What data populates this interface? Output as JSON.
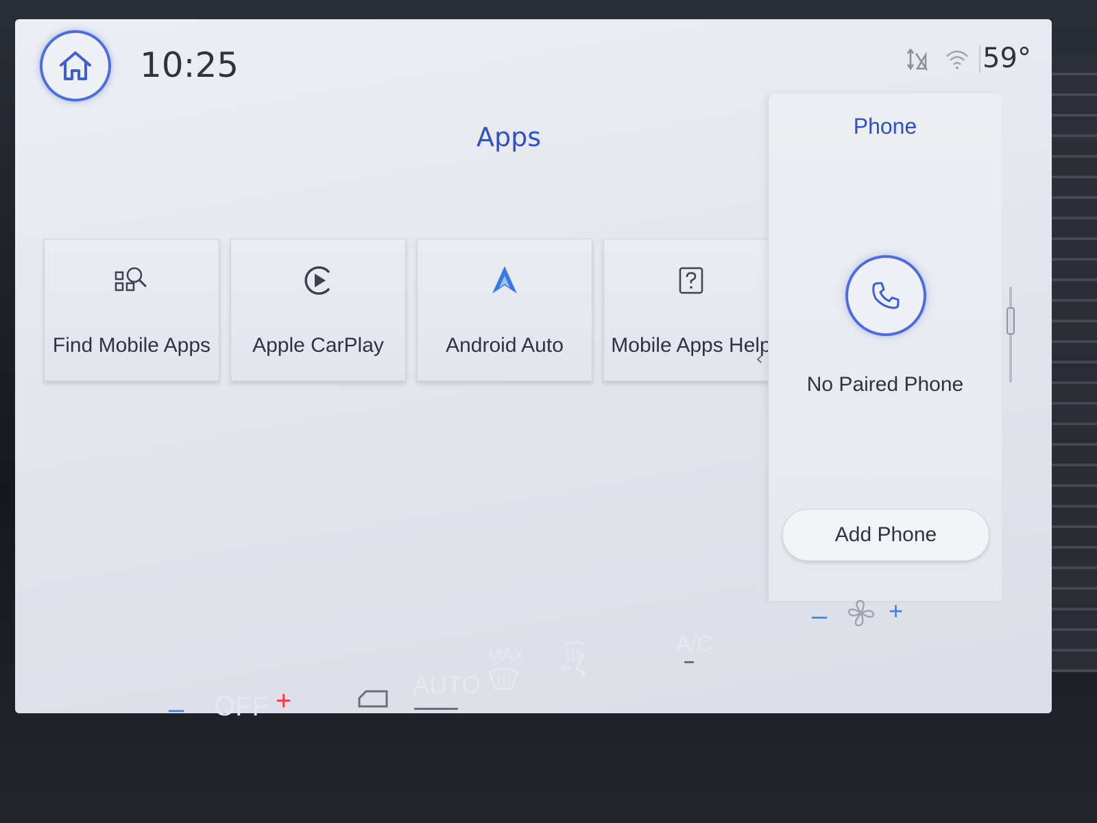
{
  "status_bar": {
    "time": "10:25",
    "temperature": "59°",
    "icons": [
      "home-icon",
      "no-gps-signal-icon",
      "wifi-icon"
    ]
  },
  "apps": {
    "title": "Apps",
    "tiles": [
      {
        "label": "Find Mobile Apps",
        "icon": "find-apps-icon"
      },
      {
        "label": "Apple CarPlay",
        "icon": "carplay-icon"
      },
      {
        "label": "Android Auto",
        "icon": "android-auto-icon"
      },
      {
        "label": "Mobile Apps Help",
        "icon": "help-icon"
      }
    ],
    "collapse_chevron": "‹"
  },
  "phone": {
    "title": "Phone",
    "status": "No Paired Phone",
    "add_button": "Add Phone"
  },
  "climate": {
    "minus": "–",
    "fan_mode": "OFF",
    "plus": "+",
    "auto": "AUTO",
    "max": "MAX",
    "ac": "A/C",
    "fan_minus": "–",
    "fan_plus": "+"
  },
  "colors": {
    "accent": "#3050c8",
    "ring": "#4a6ee0",
    "minus_blue": "#3d7dff",
    "plus_red": "#ff3b3b"
  }
}
